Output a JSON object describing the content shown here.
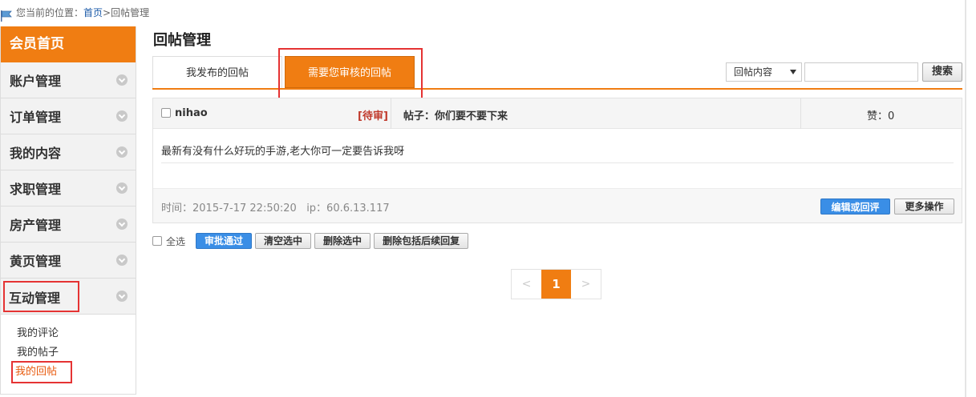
{
  "breadcrumb": {
    "prefix": "您当前的位置：",
    "home": "首页",
    "sep": " > ",
    "current": "回帖管理"
  },
  "sidebar": {
    "home": "会员首页",
    "items": [
      {
        "label": "账户管理"
      },
      {
        "label": "订单管理"
      },
      {
        "label": "我的内容"
      },
      {
        "label": "求职管理"
      },
      {
        "label": "房产管理"
      },
      {
        "label": "黄页管理"
      },
      {
        "label": "互动管理"
      }
    ],
    "sub_items": [
      {
        "label": "我的评论"
      },
      {
        "label": "我的帖子"
      },
      {
        "label": "我的回帖"
      }
    ]
  },
  "main": {
    "title": "回帖管理",
    "tabs": [
      {
        "label": "我发布的回帖"
      },
      {
        "label": "需要您审核的回帖"
      }
    ],
    "search": {
      "select_value": "回帖内容",
      "input_value": "",
      "button": "搜索"
    },
    "reply": {
      "user": "nihao",
      "status": "[待审]",
      "post_label": "帖子：你们要不要下来",
      "likes": "赞：0",
      "content": "最新有没有什么好玩的手游,老大你可一定要告诉我呀",
      "meta": "时间：2015-7-17 22:50:20   ip：60.6.13.117",
      "edit_button": "编辑或回评",
      "more_button": "更多操作"
    },
    "batch": {
      "select_all": "全选",
      "approve": "审批通过",
      "clear": "清空选中",
      "delete": "删除选中",
      "delete_all": "删除包括后续回复"
    },
    "pager": {
      "prev": "<",
      "current": "1",
      "next": ">"
    }
  },
  "colors": {
    "accent": "#f07d12",
    "highlight_outline": "#e53333",
    "primary_button": "#3a8ee6",
    "pending": "#c0392b"
  }
}
